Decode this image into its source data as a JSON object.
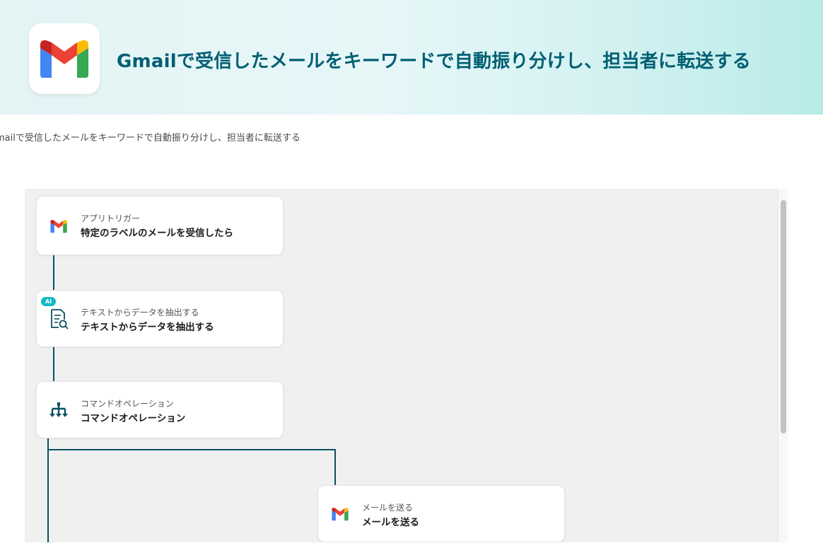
{
  "header": {
    "title": "Gmailで受信したメールをキーワードで自動振り分けし、担当者に転送する",
    "logo_icon": "gmail-icon"
  },
  "subtitle": "mailで受信したメールをキーワードで自動振り分けし、担当者に転送する",
  "colors": {
    "title": "#005f73",
    "connector": "#0b4f63",
    "ai_badge": "#13b9c4",
    "canvas_bg": "#f0f0f0"
  },
  "flow": {
    "nodes": [
      {
        "type": "アプリトリガー",
        "title": "特定のラベルのメールを受信したら",
        "icon": "gmail-icon"
      },
      {
        "type": "テキストからデータを抽出する",
        "title": "テキストからデータを抽出する",
        "icon": "document-search-icon",
        "badge": "AI"
      },
      {
        "type": "コマンドオペレーション",
        "title": "コマンドオペレーション",
        "icon": "branch-icon"
      },
      {
        "type": "メールを送る",
        "title": "メールを送る",
        "icon": "gmail-icon"
      }
    ]
  }
}
